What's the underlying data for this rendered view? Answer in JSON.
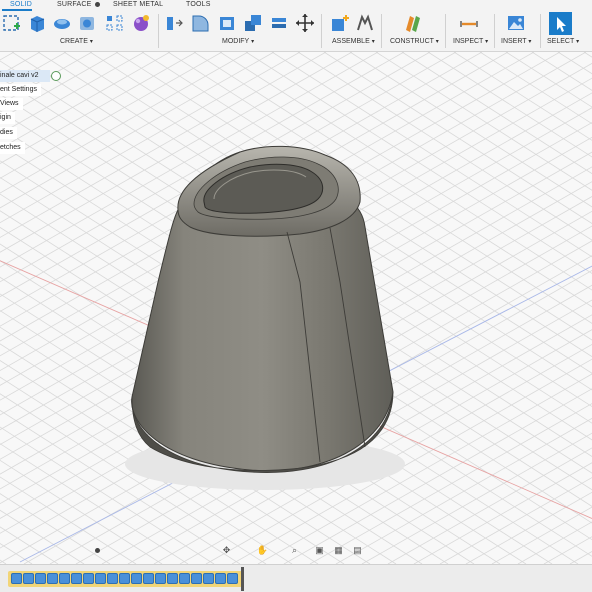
{
  "toolbar": {
    "tabs": [
      "SOLID",
      "SURFACE",
      "SHEET METAL",
      "TOOLS"
    ],
    "groups": {
      "create": "CREATE",
      "modify": "MODIFY",
      "assemble": "ASSEMBLE",
      "construct": "CONSTRUCT",
      "inspect": "INSPECT",
      "insert": "INSERT",
      "select": "SELECT"
    },
    "caret": "▾"
  },
  "browser": {
    "document_name": "inale cavi v2",
    "items": [
      "ent Settings",
      "Views",
      "igin",
      "dies",
      "etches"
    ]
  },
  "navigation": {
    "buttons": [
      "✥",
      "✋",
      "⌕",
      "▣",
      "▦",
      "▤"
    ]
  },
  "timeline": {
    "item_count": 19
  },
  "colors": {
    "accent": "#1a7cc9",
    "timeline": "#f2d577",
    "model_body": "#8a877f"
  },
  "icons": {
    "create": [
      "new-sketch-icon",
      "extrude-icon",
      "revolve-icon",
      "sweep-icon",
      "pattern-icon",
      "form-icon"
    ],
    "modify": [
      "press-pull-icon",
      "fillet-icon",
      "shell-icon",
      "combine-icon",
      "align-icon",
      "move-icon"
    ],
    "assemble": [
      "new-component-icon",
      "joint-icon"
    ],
    "construct": [
      "offset-plane-icon"
    ],
    "inspect": [
      "measure-icon"
    ],
    "insert": [
      "insert-image-icon"
    ],
    "select": [
      "select-cursor-icon"
    ]
  }
}
